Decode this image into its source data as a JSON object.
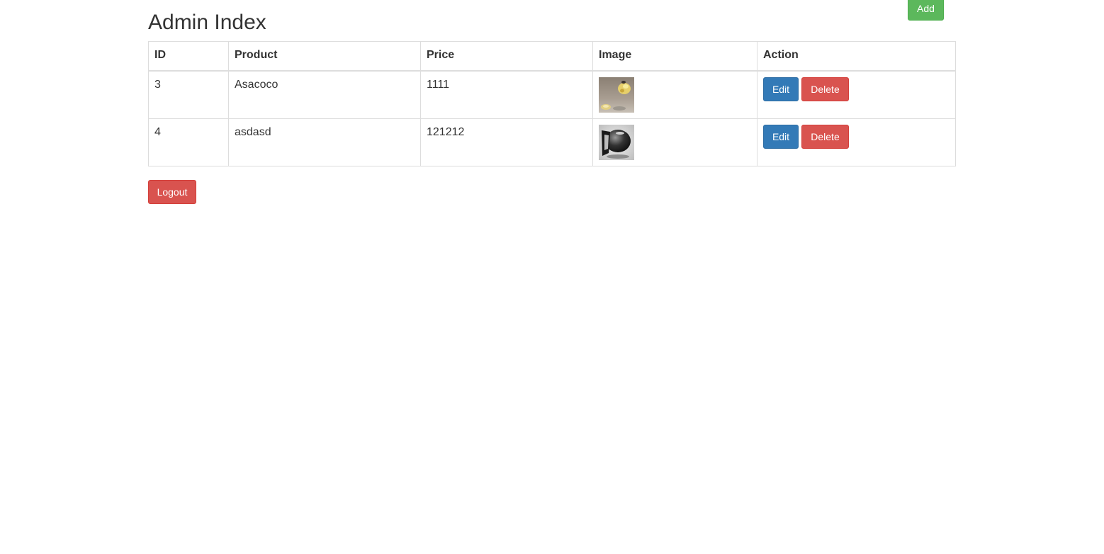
{
  "page": {
    "title": "Admin Index"
  },
  "toolbar": {
    "add_label": "Add"
  },
  "table": {
    "headers": {
      "id": "ID",
      "product": "Product",
      "price": "Price",
      "image": "Image",
      "action": "Action"
    },
    "rows": [
      {
        "id": "3",
        "product": "Asacoco",
        "price": "1111",
        "image": "product-thumbnail",
        "edit_label": "Edit",
        "delete_label": "Delete"
      },
      {
        "id": "4",
        "product": "asdasd",
        "price": "121212",
        "image": "product-thumbnail",
        "edit_label": "Edit",
        "delete_label": "Delete"
      }
    ]
  },
  "footer": {
    "logout_label": "Logout"
  },
  "colors": {
    "success": "#5cb85c",
    "primary": "#337ab7",
    "danger": "#d9534f",
    "border": "#dddddd",
    "text": "#333333"
  }
}
